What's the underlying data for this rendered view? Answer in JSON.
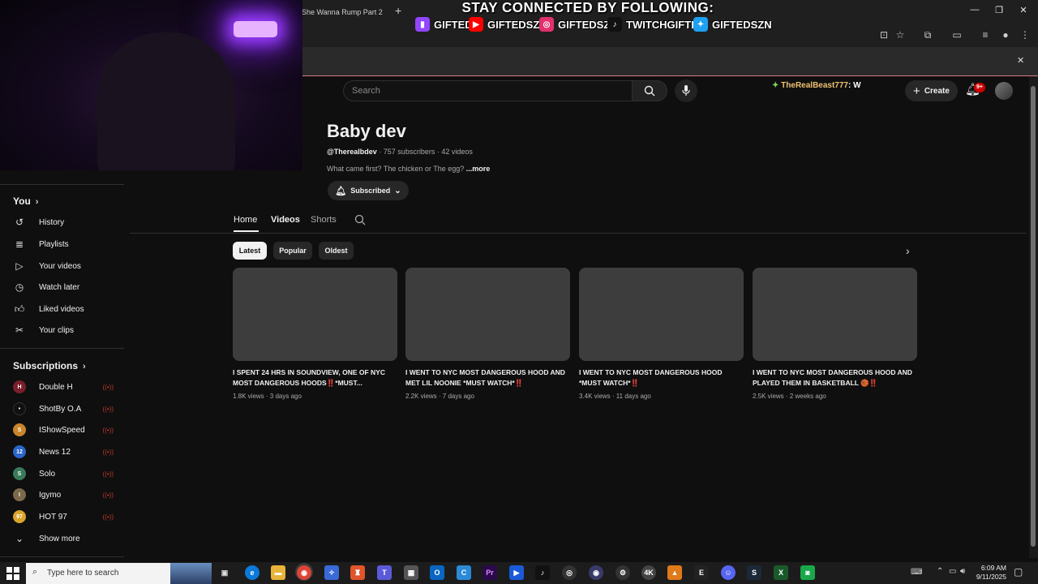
{
  "browser": {
    "tab_title": "She Wanna Rump Part 2",
    "new_tab": "+",
    "window_controls": [
      "—",
      "❐",
      "✕"
    ],
    "infobar_close": "✕"
  },
  "overlay": {
    "title": "STAY CONNECTED BY FOLLOWING:",
    "socials": [
      {
        "platform": "twitch-icon",
        "handle": "GIFTED",
        "color": "#9146ff"
      },
      {
        "platform": "youtube-icon",
        "handle": "GIFTEDSZN",
        "color": "#ff0000"
      },
      {
        "platform": "instagram-icon",
        "handle": "GIFTEDSZN",
        "color": "#e1306c"
      },
      {
        "platform": "tiktok-icon",
        "handle": "TWITCHGIFTED",
        "color": "#000000"
      },
      {
        "platform": "twitter-icon",
        "handle": "GIFTEDSZN",
        "color": "#1da1f2"
      }
    ]
  },
  "masthead": {
    "search_placeholder": "Search",
    "chat_user": "TheRealBeast777",
    "chat_message": ": W",
    "create_label": "Create",
    "notification_count": "9+"
  },
  "sidebar": {
    "you_label": "You",
    "you_items": [
      {
        "label": "History",
        "icon": "history-icon"
      },
      {
        "label": "Playlists",
        "icon": "playlists-icon"
      },
      {
        "label": "Your videos",
        "icon": "your-videos-icon"
      },
      {
        "label": "Watch later",
        "icon": "watch-later-icon"
      },
      {
        "label": "Liked videos",
        "icon": "thumbs-up-icon"
      },
      {
        "label": "Your clips",
        "icon": "scissors-icon"
      }
    ],
    "subscriptions_label": "Subscriptions",
    "subscriptions": [
      {
        "label": "Double H",
        "avatar_text": "H",
        "color": "#7a1f2b"
      },
      {
        "label": "ShotBy O.A",
        "avatar_text": "•",
        "color": "#111111"
      },
      {
        "label": "IShowSpeed",
        "avatar_text": "S",
        "color": "#c9852a"
      },
      {
        "label": "News 12",
        "avatar_text": "12",
        "color": "#2a66c9"
      },
      {
        "label": "Solo",
        "avatar_text": "S",
        "color": "#3a7a5a"
      },
      {
        "label": "Igymo",
        "avatar_text": "I",
        "color": "#7a6a4a"
      },
      {
        "label": "HOT 97",
        "avatar_text": "97",
        "color": "#d9a52a"
      }
    ],
    "show_more": "Show more"
  },
  "channel": {
    "name": "Baby dev",
    "handle": "@Therealbdev",
    "stats": " · 757 subscribers · 42 videos",
    "description": "What came first? The chicken or The egg? ",
    "more": "...more",
    "subscribed_label": "Subscribed"
  },
  "tabs": [
    "Home",
    "Videos",
    "Shorts"
  ],
  "chips": [
    "Latest",
    "Popular",
    "Oldest"
  ],
  "videos": [
    {
      "title": "I SPENT 24 HRS IN SOUNDVIEW, ONE OF NYC MOST DANGEROUS HOODS‼️*MUST...",
      "meta": "1.8K views · 3 days ago"
    },
    {
      "title": "I WENT TO NYC MOST DANGEROUS HOOD AND MET LIL NOONIE *MUST WATCH*‼️",
      "meta": "2.2K views · 7 days ago"
    },
    {
      "title": "I WENT TO NYC MOST DANGEROUS HOOD *MUST WATCH*‼️",
      "meta": "3.4K views · 11 days ago"
    },
    {
      "title": "I WENT TO NYC MOST DANGEROUS HOOD AND PLAYED THEM IN BASKETBALL 🏀‼️",
      "meta": "2.5K views · 2 weeks ago"
    }
  ],
  "taskbar": {
    "search_placeholder": "Type here to search",
    "time": "6:09 AM",
    "date": "9/11/2025"
  }
}
